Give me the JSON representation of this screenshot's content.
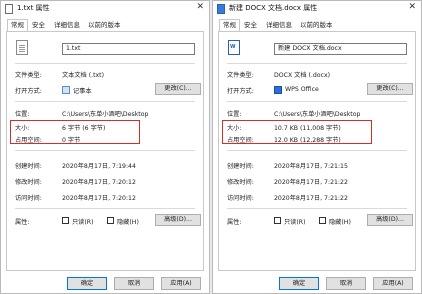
{
  "tabs_left": [
    "常规",
    "安全",
    "详细信息",
    "以前的版本"
  ],
  "tabs_right": [
    "常规",
    "安全",
    "详细信息",
    "以前的版本"
  ],
  "left": {
    "title": "1.txt 属性",
    "filename": "1.txt",
    "type_label": "文件类型:",
    "type_value": "文本文档 (.txt)",
    "open_label": "打开方式:",
    "open_app": "记事本",
    "change_button": "更改(C)...",
    "location_label": "位置:",
    "location_value": "C:\\Users\\东单小酒吧\\Desktop",
    "size_label": "大小:",
    "size_value": "6 字节 (6 字节)",
    "disk_label": "占用空间:",
    "disk_value": "0 字节",
    "created_label": "创建时间:",
    "created_value": "2020年8月17日, 7:19:44",
    "modified_label": "修改时间:",
    "modified_value": "2020年8月17日, 7:20:12",
    "accessed_label": "访问时间:",
    "accessed_value": "2020年8月17日, 7:20:12",
    "attr_label": "属性:",
    "readonly_label": "只读(R)",
    "hidden_label": "隐藏(H)",
    "advanced_button": "高级(D)...",
    "ok_button": "确定",
    "cancel_button": "取消",
    "apply_button": "应用(A)"
  },
  "right": {
    "title": "新建 DOCX 文档.docx 属性",
    "filename": "新建 DOCX 文档.docx",
    "type_label": "文件类型:",
    "type_value": "DOCX 文档 (.docx)",
    "open_label": "打开方式:",
    "open_app": "WPS Office",
    "change_button": "更改(C)...",
    "location_label": "位置:",
    "location_value": "C:\\Users\\东单小酒吧\\Desktop",
    "size_label": "大小:",
    "size_value": "10.7 KB (11,008 字节)",
    "disk_label": "占用空间:",
    "disk_value": "12.0 KB (12,288 字节)",
    "created_label": "创建时间:",
    "created_value": "2020年8月17日, 7:21:15",
    "modified_label": "修改时间:",
    "modified_value": "2020年8月17日, 7:21:22",
    "accessed_label": "访问时间:",
    "accessed_value": "2020年8月17日, 7:21:22",
    "attr_label": "属性:",
    "readonly_label": "只读(R)",
    "hidden_label": "隐藏(H)",
    "advanced_button": "高级(D)...",
    "ok_button": "确定",
    "cancel_button": "取消",
    "apply_button": "应用(A)"
  },
  "colors": {
    "highlight": "#d22f27",
    "accent": "#0078d7"
  }
}
